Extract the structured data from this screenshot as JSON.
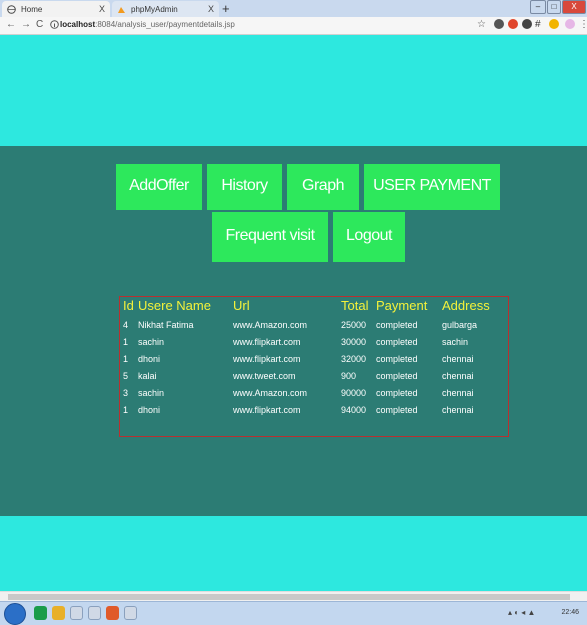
{
  "browser": {
    "tabs": [
      {
        "label": "Home",
        "close": "X"
      },
      {
        "label": "phpMyAdmin",
        "close": "X"
      }
    ],
    "new_tab": "+",
    "window_controls": {
      "minimize": "–",
      "maximize": "□",
      "close": "X"
    },
    "nav": {
      "back": "←",
      "forward": "→",
      "reload": "C"
    },
    "url_host": "localhost",
    "url_rest": ":8084/analysis_user/paymentdetails.jsp",
    "clock": "22:46"
  },
  "nav_buttons": {
    "add_offer": "AddOffer",
    "history": "History",
    "graph": "Graph",
    "user_payment": "USER PAYMENT",
    "frequent_visit": "Frequent visit",
    "logout": "Logout"
  },
  "table": {
    "headers": [
      "Id",
      "Usere Name",
      "Url",
      "Total",
      "Payment",
      "Address"
    ],
    "rows": [
      [
        "4",
        "Nikhat Fatima",
        "www.Amazon.com",
        "25000",
        "completed",
        "gulbarga"
      ],
      [
        "1",
        "sachin",
        "www.flipkart.com",
        "30000",
        "completed",
        "sachin"
      ],
      [
        "1",
        "dhoni",
        "www.flipkart.com",
        "32000",
        "completed",
        "chennai"
      ],
      [
        "5",
        "kalai",
        "www.tweet.com",
        "900",
        "completed",
        "chennai"
      ],
      [
        "3",
        "sachin",
        "www.Amazon.com",
        "90000",
        "completed",
        "chennai"
      ],
      [
        "1",
        "dhoni",
        "www.flipkart.com",
        "94000",
        "completed",
        "chennai"
      ]
    ]
  },
  "colors": {
    "light_band": "#2de8df",
    "dark_band": "#2c7c74",
    "button": "#2de85c",
    "header_text": "#f4f23a",
    "table_border": "#b83030"
  }
}
